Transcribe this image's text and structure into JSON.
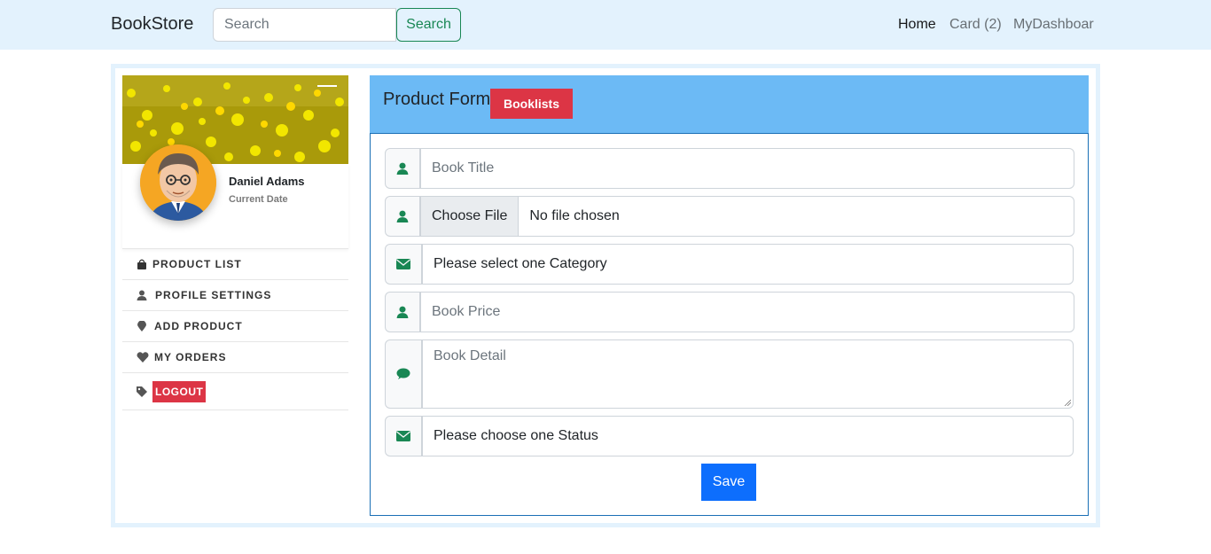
{
  "navbar": {
    "brand": "BookStore",
    "search_placeholder": "Search",
    "search_button": "Search",
    "links": [
      "Home",
      "Card (2)",
      "MyDashboar"
    ]
  },
  "profile": {
    "name": "Daniel Adams",
    "date_label": "Current Date"
  },
  "menu": {
    "items": [
      "PRODUCT LIST",
      "PROFILE SETTINGS",
      "ADD PRODUCT",
      "MY ORDERS"
    ],
    "logout": "LOGOUT"
  },
  "form": {
    "title": "Product Form",
    "booklists_button": "Booklists",
    "book_title_placeholder": "Book Title",
    "choose_file_button": "Choose File",
    "file_status": "No file chosen",
    "category_select": "Please select one Category",
    "book_price_placeholder": "Book Price",
    "book_detail_placeholder": "Book Detail",
    "status_select": "Please choose one Status",
    "save_button": "Save"
  },
  "colors": {
    "navbar_bg": "#e3f2fd",
    "header_bg": "#6cbaf5",
    "danger": "#dc3545",
    "primary": "#0d6efd",
    "success": "#198754"
  },
  "icons": {
    "product_list": "shopping-bag-icon",
    "profile_settings": "user-icon",
    "add_product": "map-pin-icon",
    "my_orders": "heart-icon",
    "logout": "tag-icon",
    "book_title": "user-icon",
    "file": "user-icon",
    "category": "envelope-icon",
    "price": "user-icon",
    "detail": "comment-icon",
    "status": "envelope-icon"
  }
}
